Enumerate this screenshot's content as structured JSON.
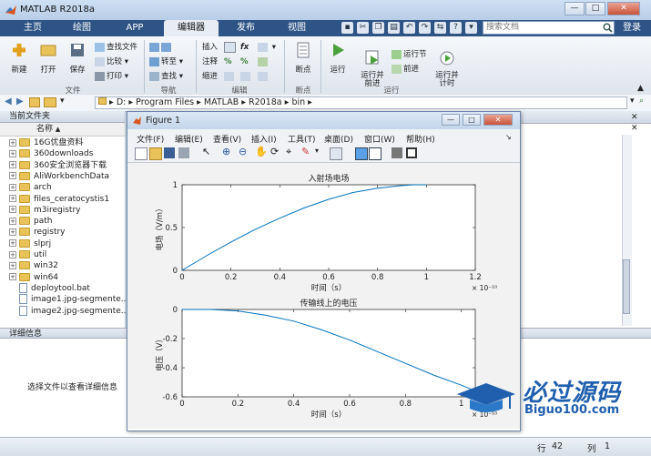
{
  "app": {
    "title": "MATLAB R2018a"
  },
  "window_controls": {
    "minimize": "—",
    "maximize": "□",
    "close": "✕"
  },
  "tabs": [
    {
      "label": "主页"
    },
    {
      "label": "绘图"
    },
    {
      "label": "APP"
    },
    {
      "label": "编辑器",
      "active": true
    },
    {
      "label": "发布"
    },
    {
      "label": "视图"
    }
  ],
  "search": {
    "placeholder": "搜索文档"
  },
  "login": "登录",
  "ribbon": {
    "file": {
      "new": "新建",
      "open": "打开",
      "save": "保存",
      "find_files": "查找文件",
      "compare": "比较",
      "print": "打印",
      "group": "文件"
    },
    "nav": {
      "goto": "转至",
      "find": "查找",
      "group": "导航"
    },
    "edit": {
      "insert": "插入",
      "comment": "注释",
      "indent": "缩进",
      "fx": "fx",
      "group": "编辑"
    },
    "breakpoints": {
      "label": "断点",
      "group": "断点"
    },
    "run": {
      "run": "运行",
      "run_advance": "运行并\n前进",
      "run_section": "运行节",
      "advance": "前进",
      "run_time": "运行并\n计时",
      "group": "运行"
    }
  },
  "address": {
    "parts": [
      "D:",
      "Program Files",
      "MATLAB",
      "R2018a",
      "bin"
    ]
  },
  "current_folder": {
    "header": "当前文件夹",
    "column": "名称",
    "items": [
      {
        "name": "16G优盘资料",
        "type": "folder"
      },
      {
        "name": "360downloads",
        "type": "folder"
      },
      {
        "name": "360安全浏览器下载",
        "type": "folder"
      },
      {
        "name": "AliWorkbenchData",
        "type": "folder"
      },
      {
        "name": "arch",
        "type": "folder"
      },
      {
        "name": "files_ceratocystis1",
        "type": "folder"
      },
      {
        "name": "m3iregistry",
        "type": "folder"
      },
      {
        "name": "path",
        "type": "folder"
      },
      {
        "name": "registry",
        "type": "folder"
      },
      {
        "name": "slprj",
        "type": "folder"
      },
      {
        "name": "util",
        "type": "folder"
      },
      {
        "name": "win32",
        "type": "folder"
      },
      {
        "name": "win64",
        "type": "folder"
      },
      {
        "name": "deploytool.bat",
        "type": "file"
      },
      {
        "name": "image1.jpg-segmente...",
        "type": "file"
      },
      {
        "name": "image2.jpg-segmente...",
        "type": "file"
      }
    ]
  },
  "details": {
    "header": "详细信息",
    "text": "选择文件以查看详细信息"
  },
  "status": {
    "row_label": "行",
    "row": "42",
    "col_label": "列",
    "col": "1"
  },
  "figure": {
    "title": "Figure 1",
    "menu": [
      "文件(F)",
      "编辑(E)",
      "查看(V)",
      "插入(I)",
      "工具(T)",
      "桌面(D)",
      "窗口(W)",
      "帮助(H)"
    ],
    "plot1": {
      "title": "入射场电场",
      "xlabel": "时间（s）",
      "ylabel": "电场（V/m）",
      "xticks": [
        "0",
        "0.2",
        "0.4",
        "0.6",
        "0.8",
        "1",
        "1.2"
      ],
      "yticks": [
        "0",
        "0.5",
        "1"
      ],
      "exponent": "× 10⁻¹⁰"
    },
    "plot2": {
      "title": "传输线上的电压",
      "xlabel": "时间（s）",
      "ylabel": "电压（V）",
      "xticks": [
        "0",
        "0.2",
        "0.4",
        "0.6",
        "0.8",
        "1"
      ],
      "yticks": [
        "0",
        "-0.2",
        "-0.4",
        "-0.6"
      ],
      "exponent": "× 10⁻¹⁰"
    }
  },
  "chart_data": [
    {
      "type": "line",
      "title": "入射场电场",
      "xlabel": "时间（s）",
      "ylabel": "电场（V/m）",
      "xlim": [
        0,
        1.2
      ],
      "ylim": [
        0,
        1
      ],
      "x_exponent": -10,
      "x": [
        0,
        0.1,
        0.2,
        0.3,
        0.4,
        0.5,
        0.6,
        0.7,
        0.8,
        0.9,
        0.95,
        1.0
      ],
      "y": [
        0,
        0.17,
        0.33,
        0.48,
        0.61,
        0.73,
        0.83,
        0.91,
        0.96,
        0.99,
        1.0,
        1.0
      ]
    },
    {
      "type": "line",
      "title": "传输线上的电压",
      "xlabel": "时间（s）",
      "ylabel": "电压（V）",
      "xlim": [
        0,
        1.05
      ],
      "ylim": [
        -0.6,
        0
      ],
      "x_exponent": -10,
      "x": [
        0,
        0.1,
        0.2,
        0.3,
        0.4,
        0.5,
        0.6,
        0.7,
        0.8,
        0.9,
        1.0,
        1.05
      ],
      "y": [
        0,
        0,
        -0.01,
        -0.04,
        -0.08,
        -0.14,
        -0.21,
        -0.29,
        -0.37,
        -0.45,
        -0.52,
        -0.56
      ]
    }
  ],
  "watermark": {
    "text": "必过源码",
    "sub": "Biguo100.com"
  }
}
